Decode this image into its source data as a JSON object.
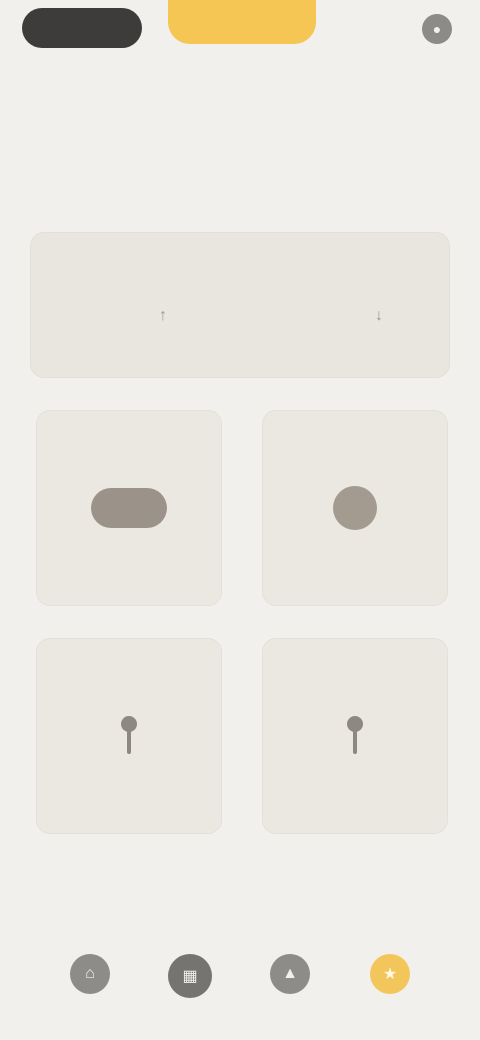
{
  "topbar": {
    "left_pill_label": "",
    "accent_pill_label": "",
    "right_label": "",
    "right_icon": "user-icon"
  },
  "header": {
    "subtitle": "",
    "meta_left": "",
    "meta_right": "",
    "hint_left": "",
    "hint_right": ""
  },
  "summary": {
    "title": "",
    "left_icon": "arrow-up-icon",
    "left_label": "",
    "right_icon": "arrow-down-icon",
    "right_label": ""
  },
  "tiles": [
    {
      "top": "",
      "bottom": "",
      "icon": "wide-icon"
    },
    {
      "top": "",
      "bottom": "",
      "icon": "round-icon"
    },
    {
      "top": "",
      "bottom": "",
      "icon": "pin-icon"
    },
    {
      "top": "",
      "bottom": "",
      "icon": "pin-icon"
    }
  ],
  "nav": [
    {
      "label": "",
      "icon": "home-icon"
    },
    {
      "label": "",
      "icon": "grid-icon"
    },
    {
      "label": "",
      "icon": "chart-icon"
    },
    {
      "label": "",
      "icon": "star-icon"
    }
  ],
  "colors": {
    "background": "#f1f0ec",
    "accent": "#f6c654",
    "dark": "#3e3c3a",
    "card": "#e9e6e0"
  }
}
